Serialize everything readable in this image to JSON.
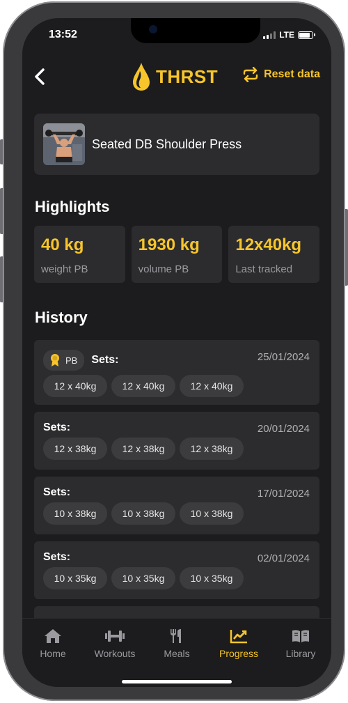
{
  "status_bar": {
    "time": "13:52",
    "network": "LTE"
  },
  "header": {
    "back_icon": "chevron-left-icon",
    "brand_icon": "drop-icon",
    "brand_name": "THRST",
    "reset_label": "Reset data",
    "reset_icon": "repeat-icon"
  },
  "exercise": {
    "name": "Seated DB Shoulder Press"
  },
  "highlights": {
    "title": "Highlights",
    "items": [
      {
        "value": "40 kg",
        "label": "weight PB"
      },
      {
        "value": "1930 kg",
        "label": "volume PB"
      },
      {
        "value": "12x40kg",
        "label": "Last tracked"
      }
    ]
  },
  "history": {
    "title": "History",
    "pb_label": "PB",
    "sets_label": "Sets:",
    "entries": [
      {
        "date": "25/01/2024",
        "pb": true,
        "sets": [
          "12 x 40kg",
          "12 x 40kg",
          "12 x 40kg"
        ]
      },
      {
        "date": "20/01/2024",
        "pb": false,
        "sets": [
          "12 x 38kg",
          "12 x 38kg",
          "12 x 38kg"
        ]
      },
      {
        "date": "17/01/2024",
        "pb": false,
        "sets": [
          "10 x 38kg",
          "10 x 38kg",
          "10 x 38kg"
        ]
      },
      {
        "date": "02/01/2024",
        "pb": false,
        "sets": [
          "10 x 35kg",
          "10 x 35kg",
          "10 x 35kg"
        ]
      }
    ]
  },
  "tabs": [
    {
      "label": "Home",
      "icon": "home-icon"
    },
    {
      "label": "Workouts",
      "icon": "dumbbell-icon"
    },
    {
      "label": "Meals",
      "icon": "cutlery-icon"
    },
    {
      "label": "Progress",
      "icon": "chart-icon",
      "active": true
    },
    {
      "label": "Library",
      "icon": "book-icon"
    }
  ],
  "colors": {
    "accent": "#f7c52b",
    "background": "#1c1c1e",
    "card": "#2c2c2e"
  }
}
